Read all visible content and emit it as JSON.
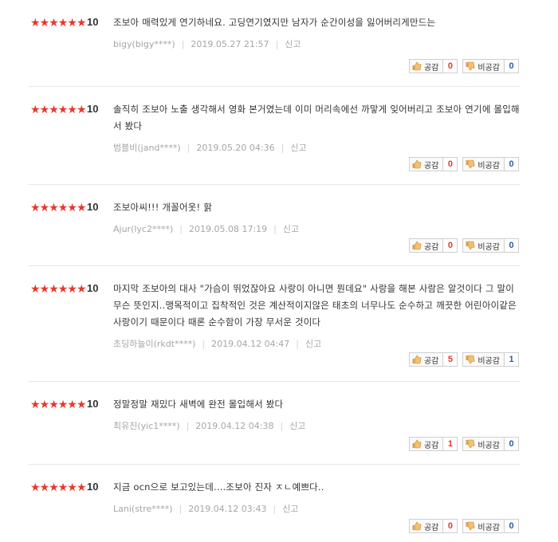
{
  "labels": {
    "agree": "공감",
    "disagree": "비공감",
    "report": "신고"
  },
  "colors": {
    "star": "#e8372c",
    "agree_count": "#e8372c",
    "disagree_count": "#2a5da8"
  },
  "reviews": [
    {
      "score": "10",
      "text": "조보아 매력있게 연기하네요. 고딩연기였지만 남자가 순간이성을 잃어버리게만드는",
      "user": "bigy(bigy****)",
      "date": "2019.05.27 21:57",
      "agree": "0",
      "disagree": "0"
    },
    {
      "score": "10",
      "text": "솔직히 조보아 노출 생각해서 영화 본거였는데 이미 머리속에선 까맣게 잊어버리고 조보아 연기에 몰입해서 봤다",
      "user": "범블비(jand****)",
      "date": "2019.05.20 04:36",
      "agree": "0",
      "disagree": "0"
    },
    {
      "score": "10",
      "text": "조보아씨!!! 개꼴어옷! 핡",
      "user": "Ajur(lyc2****)",
      "date": "2019.05.08 17:19",
      "agree": "0",
      "disagree": "0"
    },
    {
      "score": "10",
      "text": "마지막 조보아의 대사 \"가슴이 뛰었잖아요 사랑이 아니면 뭔데요\" 사랑을 해본 사람은 알것이다 그 말이 무슨 뜻인지..맹목적이고 집착적인 것은 계산적이지않은 태초의 너무나도 순수하고 깨끗한 어린아이같은 사랑이기 때문이다 때론 순수함이 가장 무서운 것이다",
      "user": "초딩하늘이(rkdt****)",
      "date": "2019.04.12 04:47",
      "agree": "5",
      "disagree": "1"
    },
    {
      "score": "10",
      "text": "정말정말 재밌다 새벽에 완전 몰입해서 봤다",
      "user": "최유진(yic1****)",
      "date": "2019.04.12 04:38",
      "agree": "1",
      "disagree": "0"
    },
    {
      "score": "10",
      "text": "지금 ocn으로 보고있는데....조보아 진자 ㅈㄴ예쁘다..",
      "user": "Lani(stre****)",
      "date": "2019.04.12 03:43",
      "agree": "0",
      "disagree": "0"
    }
  ]
}
